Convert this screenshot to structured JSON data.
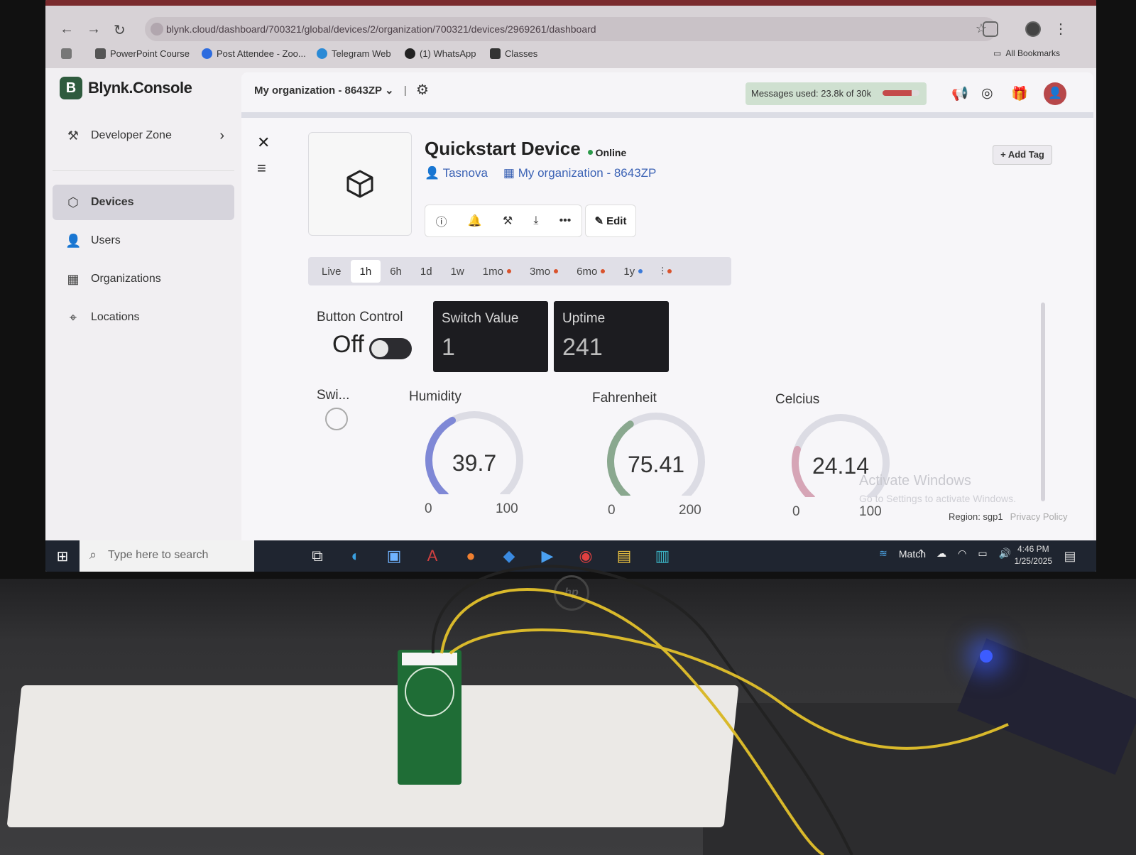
{
  "browser": {
    "url": "blynk.cloud/dashboard/700321/global/devices/2/organization/700321/devices/2969261/dashboard",
    "bookmarks": [
      "PowerPoint Course",
      "Post Attendee - Zoo...",
      "Telegram Web",
      "(1) WhatsApp",
      "Classes"
    ],
    "all_bookmarks": "All Bookmarks"
  },
  "app": {
    "logo_letter": "B",
    "logo_text": "Blynk.Console",
    "org_selector": "My organization - 8643ZP",
    "messages_used": "Messages used: 23.8k of 30k",
    "messages_fraction": 0.79
  },
  "sidebar": {
    "developer_zone": "Developer Zone",
    "items": [
      {
        "label": "Devices",
        "icon": "cube-icon",
        "active": true
      },
      {
        "label": "Users",
        "icon": "users-icon",
        "active": false
      },
      {
        "label": "Organizations",
        "icon": "building-icon",
        "active": false
      },
      {
        "label": "Locations",
        "icon": "pin-icon",
        "active": false
      }
    ]
  },
  "device": {
    "name": "Quickstart Device",
    "status": "Online",
    "owner": "Tasnova",
    "organization": "My organization - 8643ZP",
    "edit_label": "Edit",
    "add_tag_label": "Add Tag"
  },
  "time_tabs": [
    "Live",
    "1h",
    "6h",
    "1d",
    "1w",
    "1mo",
    "3mo",
    "6mo",
    "1y"
  ],
  "active_tab": "1h",
  "widgets": {
    "button_control": {
      "title": "Button Control",
      "state": "Off"
    },
    "switch_value": {
      "title": "Switch Value",
      "value": "1"
    },
    "uptime": {
      "title": "Uptime",
      "value": "241"
    },
    "switch_led": {
      "title": "Swi..."
    },
    "humidity": {
      "title": "Humidity",
      "value": "39.7",
      "min": "0",
      "max": "100",
      "fraction": 0.397
    },
    "fahrenheit": {
      "title": "Fahrenheit",
      "value": "75.41",
      "min": "0",
      "max": "200",
      "fraction": 0.377
    },
    "celcius": {
      "title": "Celcius",
      "value": "24.14",
      "min": "0",
      "max": "100",
      "fraction": 0.2414
    }
  },
  "overlay": {
    "activate_windows": "Activate Windows",
    "activate_hint": "Go to Settings to activate Windows.",
    "region": "Region: sgp1",
    "privacy": "Privacy Policy"
  },
  "taskbar": {
    "search_placeholder": "Type here to search",
    "weather": "Match",
    "time": "4:46 PM",
    "date": "1/25/2025"
  },
  "colors": {
    "accent": "#2f5b3e",
    "gauge_humidity": "#7f88d6",
    "gauge_fahrenheit": "#8aa88f",
    "gauge_celcius": "#d6a5b6",
    "gauge_track": "#dcdce4"
  }
}
